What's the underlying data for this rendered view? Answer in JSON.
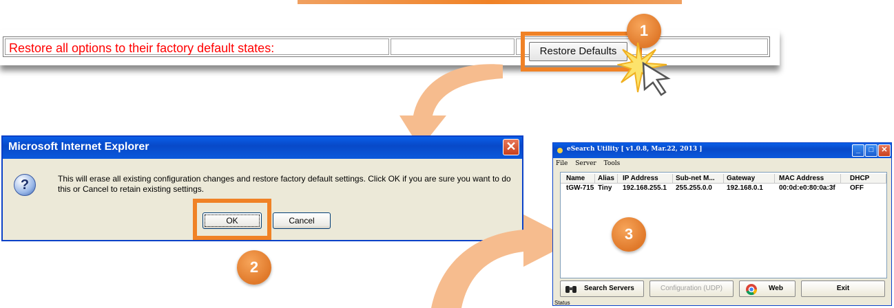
{
  "restore": {
    "label": "Restore all options to their factory default states:",
    "button_label": "Restore Defaults"
  },
  "steps": [
    "1",
    "2",
    "3"
  ],
  "ie_dialog": {
    "title": "Microsoft Internet Explorer",
    "close_glyph": "✕",
    "icon": "question-icon",
    "icon_glyph": "?",
    "message": "This will erase all existing configuration changes and restore factory default settings. Click OK if you are sure you want to do this or Cancel to retain existing settings.",
    "ok_label": "OK",
    "cancel_label": "Cancel"
  },
  "esearch": {
    "title": "eSearch Utility [ v1.0.8, Mar.22, 2013 ]",
    "menu": [
      "File",
      "Server",
      "Tools"
    ],
    "columns": [
      "Name",
      "Alias",
      "IP Address",
      "Sub-net M...",
      "Gateway",
      "MAC Address",
      "DHCP"
    ],
    "rows": [
      {
        "name": "tGW-715",
        "alias": "Tiny",
        "ip": "192.168.255.1",
        "subnet": "255.255.0.0",
        "gateway": "192.168.0.1",
        "mac": "00:0d:e0:80:0a:3f",
        "dhcp": "OFF"
      }
    ],
    "buttons": {
      "search": "Search Servers",
      "config": "Configuration (UDP)",
      "web": "Web",
      "exit": "Exit"
    },
    "status": "Status"
  },
  "colors": {
    "highlight": "#f08226",
    "arrow": "#f5b98a",
    "restore_label": "#ff0000",
    "xp_blue": "#0a58dc"
  }
}
